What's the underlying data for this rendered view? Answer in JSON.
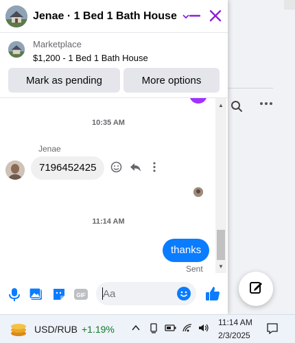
{
  "window": {
    "title": "Jenae · 1 Bed 1 Bath House",
    "chevron_icon": "chevron-down-icon",
    "minimize_icon": "minimize-icon",
    "close_icon": "close-icon",
    "accent_color": "#8b1fd8"
  },
  "listing": {
    "source": "Marketplace",
    "title": "$1,200 - 1 Bed 1 Bath House",
    "mark_pending_label": "Mark as pending",
    "more_options_label": "More options"
  },
  "messages": {
    "timestamp_1": "10:35 AM",
    "sender_name": "Jenae",
    "incoming_text": "7196452425",
    "timestamp_2": "11:14 AM",
    "outgoing_text": "thanks",
    "outgoing_status": "Sent",
    "outgoing_color": "#0a7cff"
  },
  "composer": {
    "placeholder": "Aa",
    "icons": [
      "microphone-icon",
      "photo-icon",
      "sticker-icon",
      "gif-icon",
      "emoji-icon",
      "thumbs-up-icon"
    ],
    "gif_label": "GIF"
  },
  "background": {
    "icons": [
      "search-icon",
      "more-icon",
      "compose-icon"
    ]
  },
  "taskbar": {
    "ticker_label": "USD/RUB",
    "ticker_change": "+1.19%",
    "time": "11:14 AM",
    "date": "2/3/2025",
    "tray_icons": [
      "chevron-up-icon",
      "device-icon",
      "battery-icon",
      "wifi-icon",
      "volume-icon",
      "notification-icon"
    ]
  }
}
